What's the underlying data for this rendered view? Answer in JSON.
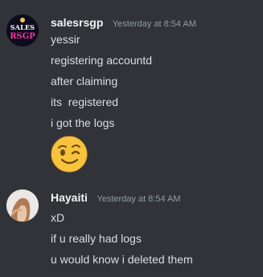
{
  "messages": [
    {
      "username": "salesrsgp",
      "timestamp": "Yesterday at 8:54 AM",
      "avatar": {
        "line1": "SALES",
        "line2": "RSGP",
        "brand_color": "#ff2ea6"
      },
      "lines": [
        "yessir",
        "registering accountd",
        "after claiming",
        "its  registered",
        "i got the logs"
      ],
      "emoji": "winking-face"
    },
    {
      "username": "Hayaiti",
      "timestamp": "Yesterday at 8:54 AM",
      "lines": [
        "xD",
        "if u really had logs",
        "u would know i deleted them"
      ]
    }
  ],
  "colors": {
    "background": "#313338",
    "username": "#f2f3f5",
    "text": "#dbdee1",
    "timestamp": "#949ba4"
  }
}
